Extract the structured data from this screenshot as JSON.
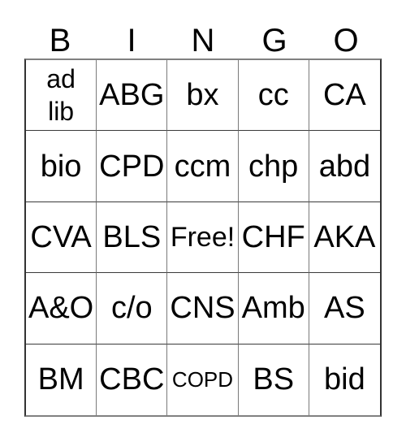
{
  "card": {
    "title": "BINGO",
    "header_letters": [
      "B",
      "I",
      "N",
      "G",
      "O"
    ],
    "free_space_label": "Free!",
    "grid_size": "5x5",
    "colors": {
      "background": "#ffffff",
      "text": "#000000",
      "border_outer": "#333333",
      "border_inner": "#7a7a7a"
    },
    "rows": [
      [
        {
          "text": "ad\nlib",
          "size": "small"
        },
        {
          "text": "ABG",
          "size": "normal"
        },
        {
          "text": "bx",
          "size": "normal"
        },
        {
          "text": "cc",
          "size": "normal"
        },
        {
          "text": "CA",
          "size": "normal"
        }
      ],
      [
        {
          "text": "bio",
          "size": "normal"
        },
        {
          "text": "CPD",
          "size": "normal"
        },
        {
          "text": "ccm",
          "size": "normal"
        },
        {
          "text": "chp",
          "size": "normal"
        },
        {
          "text": "abd",
          "size": "normal"
        }
      ],
      [
        {
          "text": "CVA",
          "size": "normal"
        },
        {
          "text": "BLS",
          "size": "normal"
        },
        {
          "text": "Free!",
          "size": "medium"
        },
        {
          "text": "CHF",
          "size": "normal"
        },
        {
          "text": "AKA",
          "size": "normal"
        }
      ],
      [
        {
          "text": "A&O",
          "size": "normal"
        },
        {
          "text": "c/o",
          "size": "normal"
        },
        {
          "text": "CNS",
          "size": "normal"
        },
        {
          "text": "Amb",
          "size": "normal"
        },
        {
          "text": "AS",
          "size": "normal"
        }
      ],
      [
        {
          "text": "BM",
          "size": "normal"
        },
        {
          "text": "CBC",
          "size": "normal"
        },
        {
          "text": "COPD",
          "size": "tiny"
        },
        {
          "text": "BS",
          "size": "normal"
        },
        {
          "text": "bid",
          "size": "normal"
        }
      ]
    ]
  }
}
